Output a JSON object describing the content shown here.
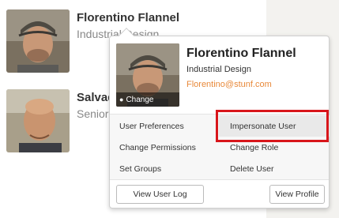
{
  "users": [
    {
      "name": "Florentino Flannel",
      "department": "Industrial Design"
    },
    {
      "name": "Salvad",
      "department": "Senior"
    }
  ],
  "popover": {
    "name": "Florentino Flannel",
    "department": "Industrial Design",
    "email": "Florentino@stunf.com",
    "photo_action": "Change",
    "actions": {
      "user_preferences": "User Preferences",
      "impersonate_user": "Impersonate User",
      "change_permissions": "Change Permissions",
      "change_role": "Change Role",
      "set_groups": "Set Groups",
      "delete_user": "Delete User"
    },
    "buttons": {
      "view_user_log": "View User Log",
      "view_profile": "View Profile"
    }
  },
  "colors": {
    "email": "#e8893a",
    "highlight": "#d8161b"
  },
  "icons": {
    "photo_change": "camera-icon"
  }
}
